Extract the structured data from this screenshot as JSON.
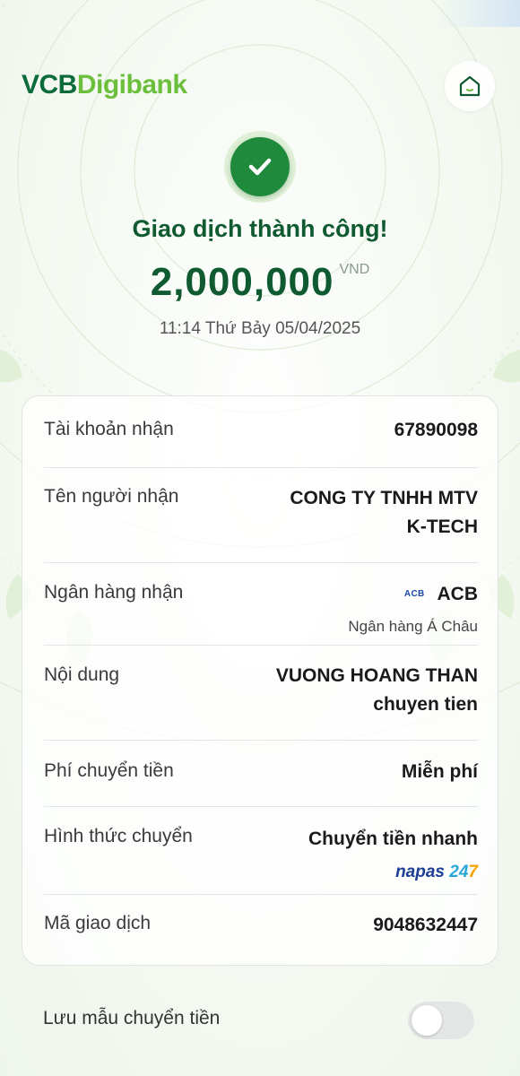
{
  "brand": {
    "logo_part1": "VCB",
    "logo_part2": "Digibank"
  },
  "header": {
    "home_icon": "home-icon"
  },
  "status": {
    "icon": "checkmark-icon",
    "title": "Giao dịch thành công!",
    "amount": "2,000,000",
    "currency": "VND",
    "datetime": "11:14 Thứ Bảy 05/04/2025"
  },
  "details": {
    "recipient_account": {
      "label": "Tài khoản nhận",
      "value": "67890098"
    },
    "recipient_name": {
      "label": "Tên người nhận",
      "value_line1": "CONG TY TNHH MTV",
      "value_line2": "K-TECH"
    },
    "recipient_bank": {
      "label": "Ngân hàng nhận",
      "badge": "ACB",
      "value": "ACB",
      "full_name": "Ngân hàng Á Châu"
    },
    "content": {
      "label": "Nội dung",
      "value_line1": "VUONG HOANG THAN",
      "value_line2": "chuyen tien"
    },
    "fee": {
      "label": "Phí chuyển tiền",
      "value": "Miễn phí"
    },
    "method": {
      "label": "Hình thức chuyển",
      "value": "Chuyển tiền nhanh",
      "logo_part1": "napas",
      "logo_part2": "24",
      "logo_part3": "7"
    },
    "transaction_id": {
      "label": "Mã giao dịch",
      "value": "9048632447"
    }
  },
  "save_template": {
    "label": "Lưu mẫu chuyển tiền",
    "enabled": false
  },
  "colors": {
    "primary_green": "#0f5a30",
    "success_green": "#1f8a3b",
    "brand_light_green": "#6cbf3c"
  }
}
